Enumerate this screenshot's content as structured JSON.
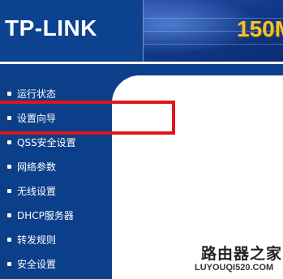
{
  "header": {
    "logo": "TP-LINK",
    "banner_text": "150M"
  },
  "sidebar": {
    "items": [
      {
        "label": "运行状态"
      },
      {
        "label": "设置向导"
      },
      {
        "label": "QSS安全设置"
      },
      {
        "label": "网络参数"
      },
      {
        "label": "无线设置"
      },
      {
        "label": "DHCP服务器"
      },
      {
        "label": "转发规则"
      },
      {
        "label": "安全设置"
      }
    ]
  },
  "annotation": {
    "color": "#e3151a"
  },
  "watermark": {
    "title": "路由器之家",
    "url": "LUYOUQI520.COM"
  },
  "colors": {
    "brand_blue": "#0b3f8a",
    "banner_yellow": "#f1c232"
  }
}
